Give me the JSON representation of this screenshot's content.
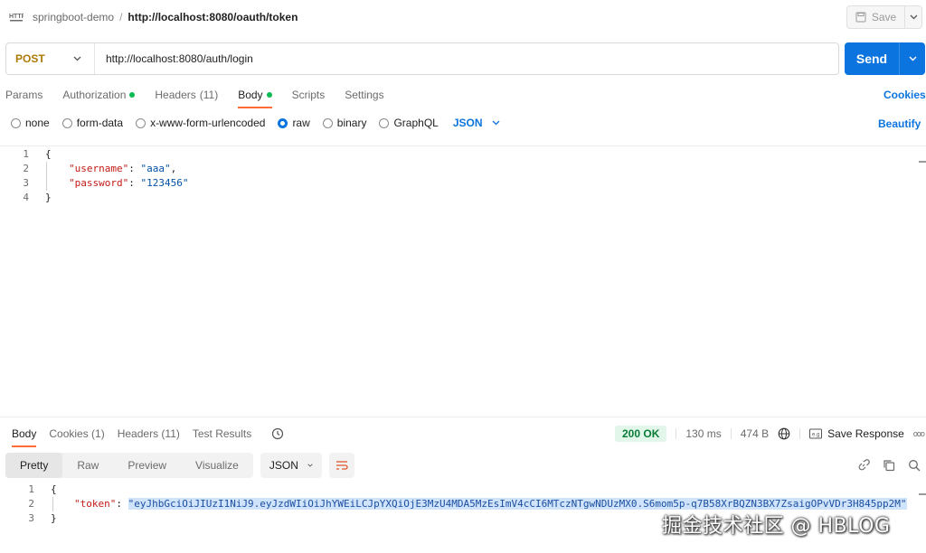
{
  "topbar": {
    "collection": "springboot-demo",
    "separator": "/",
    "request_title": "http://localhost:8080/oauth/token",
    "save_label": "Save"
  },
  "request": {
    "method": "POST",
    "url": "http://localhost:8080/auth/login",
    "send_label": "Send"
  },
  "request_tabs": [
    {
      "label": "Params",
      "dot": false,
      "count": ""
    },
    {
      "label": "Authorization",
      "dot": true,
      "count": ""
    },
    {
      "label": "Headers",
      "dot": false,
      "count": "(11)"
    },
    {
      "label": "Body",
      "dot": true,
      "count": ""
    },
    {
      "label": "Scripts",
      "dot": false,
      "count": ""
    },
    {
      "label": "Settings",
      "dot": false,
      "count": ""
    }
  ],
  "active_request_tab": "Body",
  "cookies_label": "Cookies",
  "body_options": [
    "none",
    "form-data",
    "x-www-form-urlencoded",
    "raw",
    "binary",
    "GraphQL"
  ],
  "selected_body_option": "raw",
  "body_format": "JSON",
  "beautify_label": "Beautify",
  "request_body": {
    "line_numbers": [
      "1",
      "2",
      "3",
      "4"
    ],
    "open_brace": "{",
    "close_brace": "}",
    "username_key": "\"username\"",
    "username_value": "\"aaa\"",
    "password_key": "\"password\"",
    "password_value": "\"123456\""
  },
  "response_tabs": [
    {
      "label": "Body"
    },
    {
      "label": "Cookies (1)"
    },
    {
      "label": "Headers (11)"
    },
    {
      "label": "Test Results"
    }
  ],
  "response_meta": {
    "status": "200 OK",
    "time": "130 ms",
    "size": "474 B",
    "save_response": "Save Response",
    "more": "ooo"
  },
  "response_views": [
    "Pretty",
    "Raw",
    "Preview",
    "Visualize"
  ],
  "active_response_view": "Pretty",
  "response_format": "JSON",
  "response_body": {
    "line_numbers": [
      "1",
      "2",
      "3"
    ],
    "open_brace": "{",
    "close_brace": "}",
    "token_key": "\"token\"",
    "token_value": "\"eyJhbGciOiJIUzI1NiJ9.eyJzdWIiOiJhYWEiLCJpYXQiOjE3MzU4MDA5MzEsImV4cCI6MTczNTgwNDUzMX0.S6mom5p-q7B58XrBQZN3BX7ZsaigOPvVDr3H845pp2M\""
  },
  "watermark": "掘金技术社区 @ HBLOG",
  "colors": {
    "accent": "#0b74de",
    "tab_underline": "#ff6c37",
    "status_ok": "#0a7c38",
    "method_post": "#ad7a03"
  }
}
